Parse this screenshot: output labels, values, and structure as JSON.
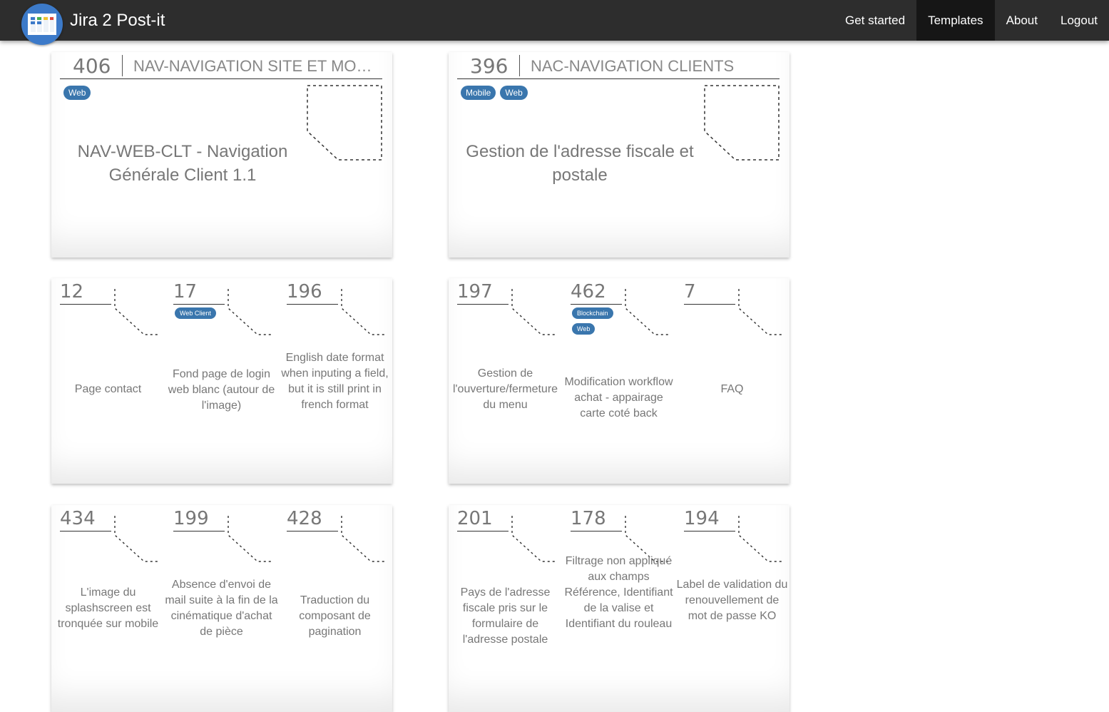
{
  "app": {
    "title": "Jira 2 Post-it"
  },
  "nav": {
    "items": [
      {
        "label": "Get started",
        "active": false
      },
      {
        "label": "Templates",
        "active": true
      },
      {
        "label": "About",
        "active": false
      },
      {
        "label": "Logout",
        "active": false
      }
    ]
  },
  "colors": {
    "navbar_bg": "#2d2d2d",
    "nav_active_bg": "#161616",
    "tag_bg": "#3a76ad",
    "logo_bg": "#3c7ac9"
  },
  "big_cards": [
    {
      "key": "406",
      "epic": "NAV-NAVIGATION SITE ET MOBILE",
      "tags": [
        "Web"
      ],
      "summary": "NAV-WEB-CLT - Navigation Générale Client 1.1"
    },
    {
      "key": "396",
      "epic": "NAC-NAVIGATION CLIENTS",
      "tags": [
        "Mobile",
        "Web"
      ],
      "summary": "Gestion de l'adresse fiscale et postale"
    }
  ],
  "small_cards": [
    [
      {
        "key": "12",
        "tags": [],
        "summary": "Page contact"
      },
      {
        "key": "17",
        "tags": [
          "Web Client"
        ],
        "summary": "Fond page de login web blanc (autour de l'image)"
      },
      {
        "key": "196",
        "tags": [],
        "summary": "English date format when inputing a field, but it is still print in french format"
      }
    ],
    [
      {
        "key": "197",
        "tags": [],
        "summary": "Gestion de l'ouverture/fermeture du menu"
      },
      {
        "key": "462",
        "tags": [
          "Blockchain",
          "Web"
        ],
        "summary": "Modification workflow achat - appairage carte coté back"
      },
      {
        "key": "7",
        "tags": [],
        "summary": "FAQ"
      }
    ],
    [
      {
        "key": "434",
        "tags": [],
        "summary": "L'image du splashscreen est tronquée sur mobile"
      },
      {
        "key": "199",
        "tags": [],
        "summary": "Absence d'envoi de mail suite à la fin de la cinématique d'achat de pièce"
      },
      {
        "key": "428",
        "tags": [],
        "summary": "Traduction du composant de pagination"
      }
    ],
    [
      {
        "key": "201",
        "tags": [],
        "summary": "Pays de l'adresse fiscale pris sur le formulaire de l'adresse postale"
      },
      {
        "key": "178",
        "tags": [],
        "summary": "Filtrage non appliqué aux champs Référence, Identifiant de la valise et Identifiant du rouleau"
      },
      {
        "key": "194",
        "tags": [],
        "summary": "Label de validation du renouvellement de mot de passe KO"
      }
    ]
  ]
}
